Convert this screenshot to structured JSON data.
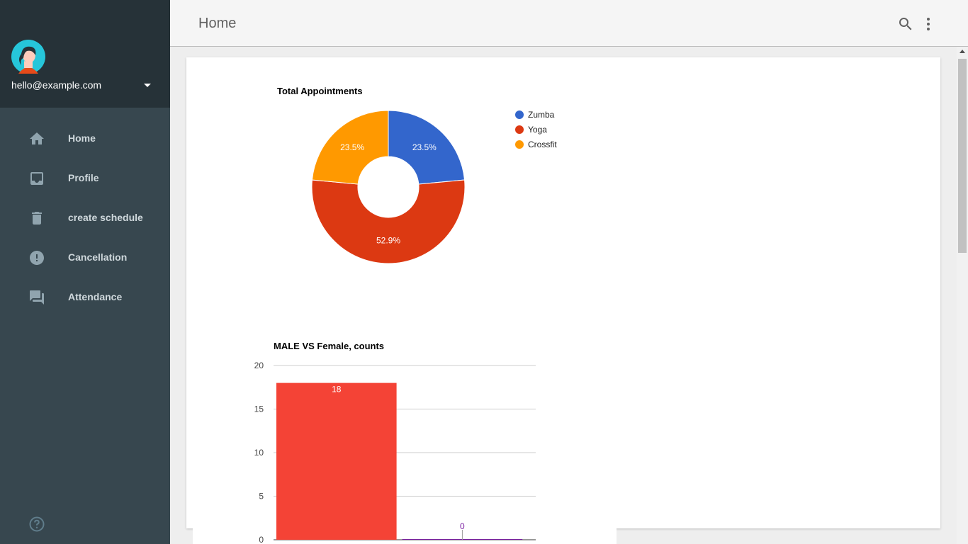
{
  "drawer": {
    "email": "hello@example.com",
    "nav": [
      {
        "label": "Home",
        "icon": "home-icon"
      },
      {
        "label": "Profile",
        "icon": "inbox-icon"
      },
      {
        "label": "create schedule",
        "icon": "trash-icon"
      },
      {
        "label": "Cancellation",
        "icon": "alert-icon"
      },
      {
        "label": "Attendance",
        "icon": "forum-icon"
      }
    ]
  },
  "appbar": {
    "title": "Home"
  },
  "colors": {
    "drawer_bg": "#37474f",
    "drawer_header_bg": "#263238",
    "nav_text": "#cfd8dc",
    "zumba": "#3366cc",
    "yoga": "#dc3912",
    "crossfit": "#ff9900",
    "male": "#f44336",
    "female": "#7b1fa2"
  },
  "chart_data": [
    {
      "type": "pie",
      "title": "Total Appointments",
      "donut": true,
      "legend": "right",
      "categories": [
        "Zumba",
        "Yoga",
        "Crossfit"
      ],
      "values": [
        23.5,
        52.9,
        23.5
      ],
      "labels": [
        "23.5%",
        "52.9%",
        "23.5%"
      ]
    },
    {
      "type": "bar",
      "title": "MALE VS Female, counts",
      "values": [
        18,
        0
      ],
      "data_labels": [
        "18",
        "0"
      ],
      "yticks": [
        "0",
        "5",
        "10",
        "15",
        "20"
      ],
      "ylim": [
        0,
        20
      ],
      "grid": true
    }
  ]
}
